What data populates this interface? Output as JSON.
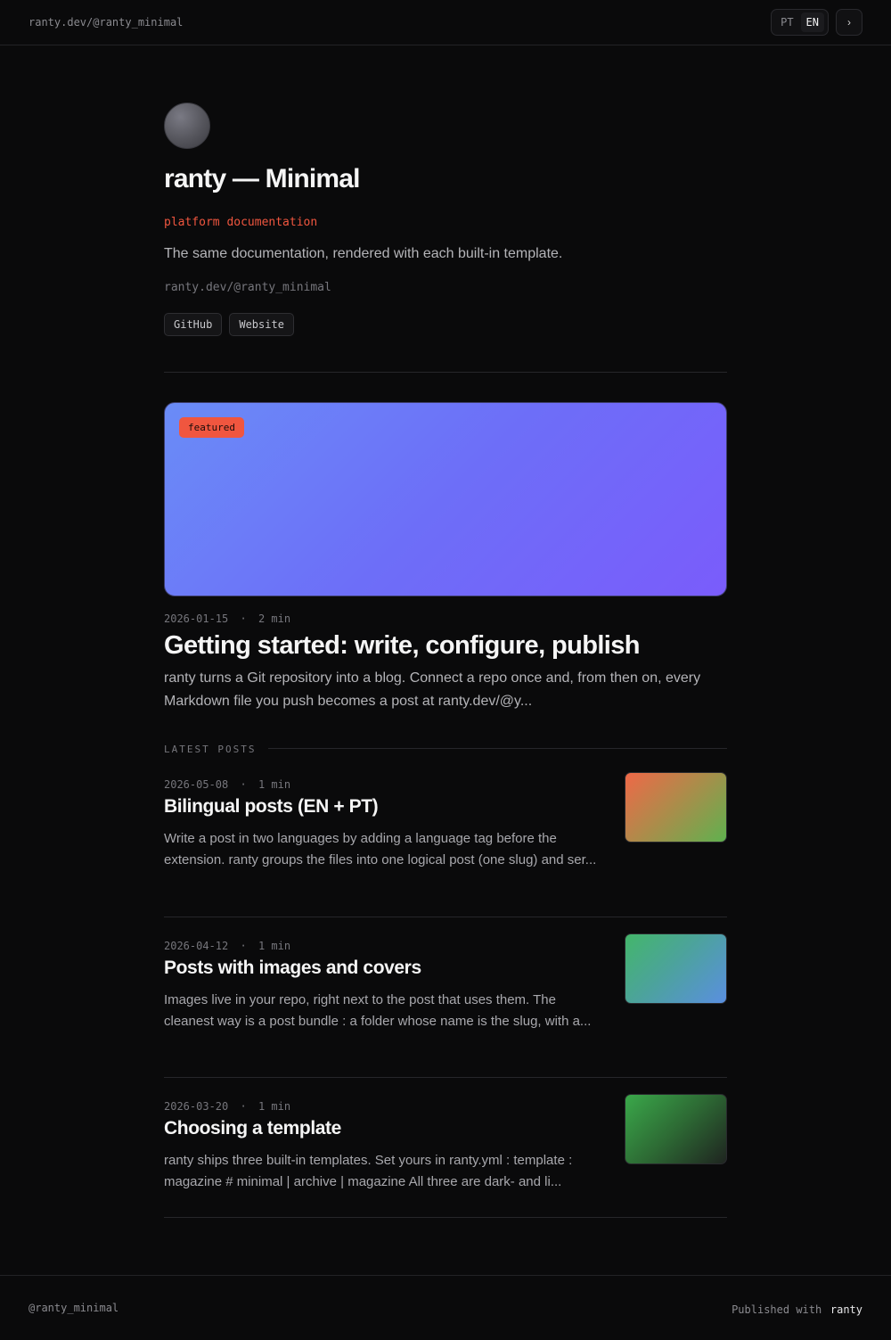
{
  "topbar": {
    "handle_url": "ranty.dev/@ranty_minimal",
    "languages": [
      {
        "label": "PT",
        "active": false
      },
      {
        "label": "EN",
        "active": true
      }
    ],
    "theme_toggle_glyph": "›"
  },
  "profile": {
    "avatar_icon": "avatar",
    "title": "ranty — Minimal",
    "tagline": "platform documentation",
    "description": "The same documentation, rendered with each built-in template.",
    "url": "ranty.dev/@ranty_minimal",
    "links": [
      {
        "label": "GitHub"
      },
      {
        "label": "Website"
      }
    ]
  },
  "featured": {
    "badge": "featured",
    "date": "2026-01-15",
    "read_time": "2 min",
    "title": "Getting started: write, configure, publish",
    "excerpt": "ranty turns a Git repository into a blog. Connect a repo once and, from then on, every Markdown file you push becomes a post at ranty.dev/@y..."
  },
  "latest": {
    "label": "LATEST POSTS",
    "separator": "·",
    "posts": [
      {
        "date": "2026-05-08",
        "read_time": "1 min",
        "title": "Bilingual posts (EN + PT)",
        "excerpt": "Write a post in two languages by adding a language tag before the extension. ranty groups the files into one logical post (one slug) and ser..."
      },
      {
        "date": "2026-04-12",
        "read_time": "1 min",
        "title": "Posts with images and covers",
        "excerpt": "Images live in your repo, right next to the post that uses them. The cleanest way is a post bundle : a folder whose name is the slug, with a..."
      },
      {
        "date": "2026-03-20",
        "read_time": "1 min",
        "title": "Choosing a template",
        "excerpt": "ranty ships three built-in templates. Set yours in ranty.yml : template : magazine # minimal | archive | magazine All three are dark- and li..."
      }
    ]
  },
  "footer": {
    "handle": "@ranty_minimal",
    "published_with": "Published with",
    "brand": "ranty"
  },
  "colors": {
    "background": "#0a0a0b",
    "accent": "#f0563f",
    "text_primary": "#f5f5f5",
    "text_muted": "#76767c"
  }
}
